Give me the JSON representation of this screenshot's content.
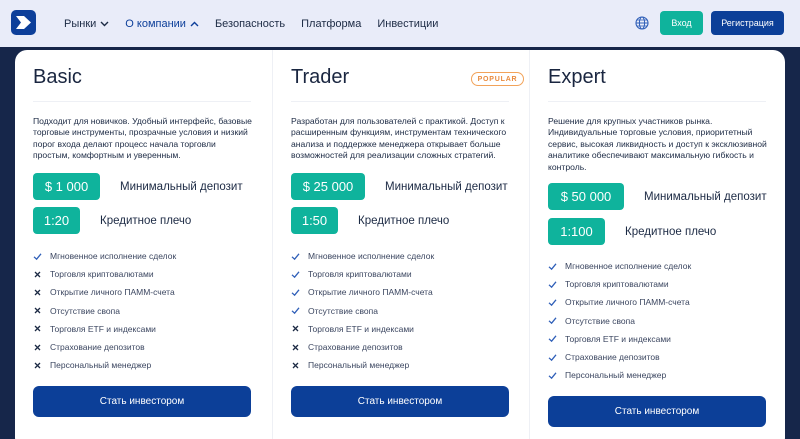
{
  "header": {
    "nav": [
      {
        "label": "Рынки",
        "has_dropdown": true,
        "active": false
      },
      {
        "label": "О компании",
        "has_dropdown": true,
        "active": true
      },
      {
        "label": "Безопасность",
        "has_dropdown": false,
        "active": false
      },
      {
        "label": "Платформа",
        "has_dropdown": false,
        "active": false
      },
      {
        "label": "Инвестиции",
        "has_dropdown": false,
        "active": false
      }
    ],
    "language_icon": "globe-icon",
    "login_label": "Вход",
    "register_label": "Регистрация"
  },
  "plans": [
    {
      "title": "Basic",
      "badge": "",
      "description": "Подходит для новичков. Удобный интерфейс, базовые торговые инструменты, прозрачные условия и низкий порог входа делают процесс начала торговли простым, комфортным и уверенным.",
      "deposit_value": "$ 1 000",
      "deposit_label": "Минимальный депозит",
      "leverage_value": "1:20",
      "leverage_label": "Кредитное плечо",
      "features": [
        {
          "label": "Мгновенное исполнение сделок",
          "included": true
        },
        {
          "label": "Торговля криптовалютами",
          "included": false
        },
        {
          "label": "Открытие личного ПАММ-счета",
          "included": false
        },
        {
          "label": "Отсутствие свопа",
          "included": false
        },
        {
          "label": "Торговля ETF и индексами",
          "included": false
        },
        {
          "label": "Страхование депозитов",
          "included": false
        },
        {
          "label": "Персональный менеджер",
          "included": false
        }
      ],
      "cta_label": "Стать инвестором"
    },
    {
      "title": "Trader",
      "badge": "POPULAR",
      "description": "Разработан для пользователей с практикой. Доступ к расширенным функциям, инструментам технического анализа и поддержке менеджера открывает больше возможностей для реализации сложных стратегий.",
      "deposit_value": "$ 25 000",
      "deposit_label": "Минимальный депозит",
      "leverage_value": "1:50",
      "leverage_label": "Кредитное плечо",
      "features": [
        {
          "label": "Мгновенное исполнение сделок",
          "included": true
        },
        {
          "label": "Торговля криптовалютами",
          "included": true
        },
        {
          "label": "Открытие личного ПАММ-счета",
          "included": true
        },
        {
          "label": "Отсутствие свопа",
          "included": true
        },
        {
          "label": "Торговля ETF и индексами",
          "included": false
        },
        {
          "label": "Страхование депозитов",
          "included": false
        },
        {
          "label": "Персональный менеджер",
          "included": false
        }
      ],
      "cta_label": "Стать инвестором"
    },
    {
      "title": "Expert",
      "badge": "",
      "description": "Решение для крупных участников рынка. Индивидуальные торговые условия, приоритетный сервис, высокая ликвидность и доступ к эксклюзивной аналитике обеспечивают максимальную гибкость и контроль.",
      "deposit_value": "$ 50 000",
      "deposit_label": "Минимальный депозит",
      "leverage_value": "1:100",
      "leverage_label": "Кредитное плечо",
      "features": [
        {
          "label": "Мгновенное исполнение сделок",
          "included": true
        },
        {
          "label": "Торговля криптовалютами",
          "included": true
        },
        {
          "label": "Открытие личного ПАММ-счета",
          "included": true
        },
        {
          "label": "Отсутствие свопа",
          "included": true
        },
        {
          "label": "Торговля ETF и индексами",
          "included": true
        },
        {
          "label": "Страхование депозитов",
          "included": true
        },
        {
          "label": "Персональный менеджер",
          "included": true
        }
      ],
      "cta_label": "Стать инвестором"
    }
  ],
  "colors": {
    "brand": "#0c3f98",
    "accent": "#0fb39c",
    "badge": "#e98b3e",
    "check": "#2f5fb8",
    "cross": "#1c2a44"
  }
}
